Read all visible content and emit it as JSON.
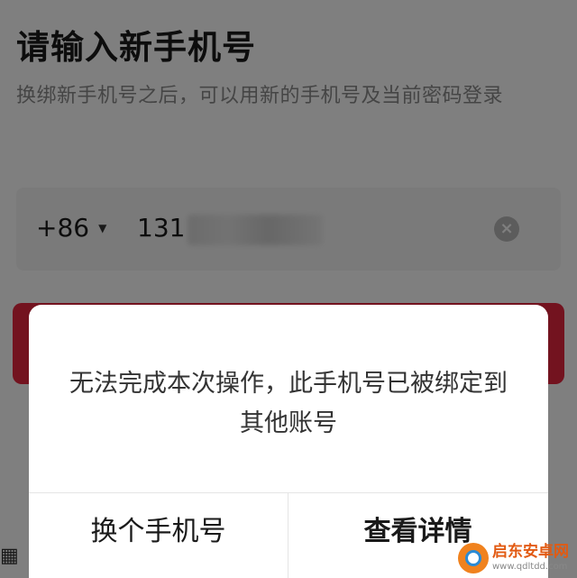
{
  "page": {
    "title": "请输入新手机号",
    "subtitle": "换绑新手机号之后，可以用新的手机号及当前密码登录"
  },
  "phone_input": {
    "country_code": "+86",
    "number_prefix": "131"
  },
  "dialog": {
    "message": "无法完成本次操作，此手机号已被绑定到其他账号",
    "left_button": "换个手机号",
    "right_button": "查看详情"
  },
  "watermark": {
    "name": "启东安卓网",
    "url": "www.qdltdd.com"
  },
  "colors": {
    "accent": "#e6263f",
    "mask": "rgba(0,0,0,0.5)"
  }
}
